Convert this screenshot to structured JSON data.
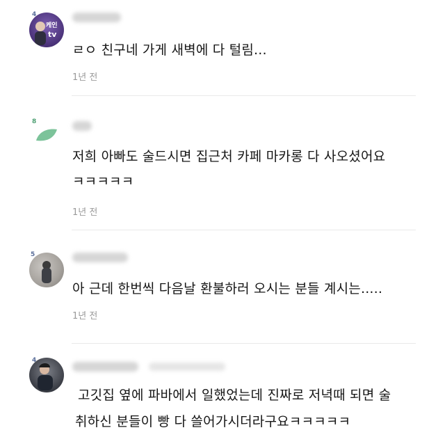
{
  "comments": [
    {
      "level_badge": "4",
      "avatar_text_top": "케인",
      "avatar_text_bottom": "tv",
      "text_lines": [
        "ㄹㅇ 친구네 가게 새벽에 다 털림..."
      ],
      "time": "1년 전"
    },
    {
      "level_badge": "8",
      "text_lines": [
        "저희 아빠도 술드시면 집근처 카페 마카롱 다 사오셨어요",
        "ㅋㅋㅋㅋㅋ"
      ],
      "time": "1년 전"
    },
    {
      "level_badge": "5",
      "text_lines": [
        "아 근데 한번씩 다음날 환불하러 오시는 분들 계시는....."
      ],
      "time": "1년 전"
    },
    {
      "level_badge": "4",
      "text_lines": [
        "고깃집 옆에 파바에서 일했었는데 진짜로 저녁때 되면 술",
        "취하신 분들이 빵 다 쓸어가시더라구요ㅋㅋㅋㅋㅋ"
      ]
    }
  ],
  "colors": {
    "text": "#161616",
    "time": "#9a9a9a",
    "divider": "#e9e9e9",
    "leaf": "#7cc39a"
  }
}
